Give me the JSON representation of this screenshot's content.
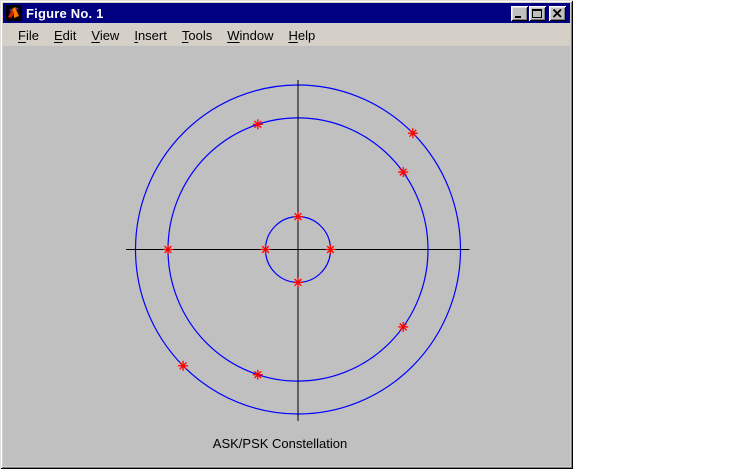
{
  "window": {
    "title": "Figure No. 1",
    "icons": {
      "app": "matlab-logo-icon",
      "minimize": "minimize-icon",
      "maximize": "maximize-icon",
      "close": "close-icon"
    }
  },
  "menu": {
    "items": [
      {
        "label": "File",
        "mnemonic": "F"
      },
      {
        "label": "Edit",
        "mnemonic": "E"
      },
      {
        "label": "View",
        "mnemonic": "V"
      },
      {
        "label": "Insert",
        "mnemonic": "I"
      },
      {
        "label": "Tools",
        "mnemonic": "T"
      },
      {
        "label": "Window",
        "mnemonic": "W"
      },
      {
        "label": "Help",
        "mnemonic": "H"
      }
    ]
  },
  "figure": {
    "caption": "ASK/PSK Constellation"
  },
  "chart_data": {
    "type": "scatter",
    "title": "ASK/PSK Constellation",
    "description": "Circular ASK/PSK signal constellation: red asterisk signal points on three concentric blue amplitude rings with unlabeled black crosshair axes",
    "rings": [
      {
        "amplitude": 1,
        "num_points": 4,
        "phases_deg": [
          0,
          90,
          180,
          270
        ]
      },
      {
        "amplitude": 4,
        "num_points": 5,
        "phases_deg": [
          36,
          108,
          180,
          252,
          324
        ]
      },
      {
        "amplitude": 5,
        "num_points": 2,
        "phases_deg": [
          45,
          225
        ]
      }
    ],
    "amplitude_levels": [
      1,
      4,
      5
    ],
    "num_points_total": 11,
    "axes": {
      "x_ticks": [],
      "y_ticks": [],
      "box": false,
      "grid": false
    },
    "colors": {
      "ring_stroke": "#0000ff",
      "point": "#ff0000",
      "axis": "#000000",
      "figure_background": "#c0c0c0"
    }
  }
}
